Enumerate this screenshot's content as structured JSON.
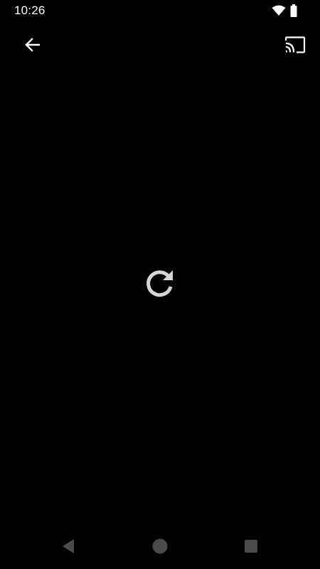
{
  "status_bar": {
    "time": "10:26",
    "icons": [
      "wifi-icon",
      "battery-icon"
    ]
  },
  "app_bar": {
    "back_icon": "arrow-back-icon",
    "cast_icon": "cast-icon"
  },
  "content": {
    "reload_icon": "refresh-icon"
  },
  "nav_bar": {
    "buttons": [
      "nav-back-icon",
      "nav-home-icon",
      "nav-recents-icon"
    ]
  },
  "colors": {
    "background": "#000000",
    "foreground": "#ffffff",
    "reload": "#d6d6d6",
    "nav": "#4a4a4a"
  }
}
